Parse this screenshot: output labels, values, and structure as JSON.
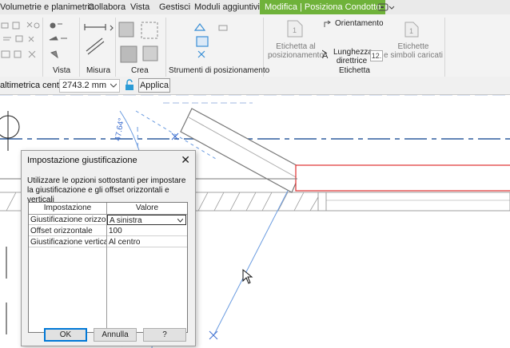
{
  "tabs": [
    "Volumetrie e planimetria",
    "Collabora",
    "Vista",
    "Gestisci",
    "Moduli aggiuntivi",
    "Modifica | Posiziona Condotto"
  ],
  "ribbon": {
    "panels": [
      "Vista",
      "Misura",
      "Crea",
      "Strumenti di posizionamento",
      "Etichetta"
    ],
    "etichetta_al": [
      "Etichetta al",
      "posizionamento"
    ],
    "orientamento": "Orientamento",
    "lunghezza": [
      "Lunghezza",
      "direttrice"
    ],
    "lunghezza_value": "12.",
    "etichette": [
      "Etichette",
      "e simboli caricati"
    ]
  },
  "options": {
    "label": "altimetrica centrale:",
    "value": "2743.2 mm",
    "apply": "Applica"
  },
  "canvas": {
    "dim_text": "47.64°"
  },
  "dialog": {
    "title": "Impostazione giustificazione",
    "description": "Utilizzare le opzioni sottostanti per impostare la giustificazione e gli offset orizzontali e verticali",
    "columns": [
      "Impostazione",
      "Valore"
    ],
    "rows": [
      {
        "name": "Giustificazione orizzontale",
        "value": "A sinistra"
      },
      {
        "name": "Offset orizzontale",
        "value": "100"
      },
      {
        "name": "Giustificazione verticale",
        "value": "Al centro"
      }
    ],
    "buttons": {
      "ok": "OK",
      "cancel": "Annulla",
      "help": "?"
    }
  }
}
